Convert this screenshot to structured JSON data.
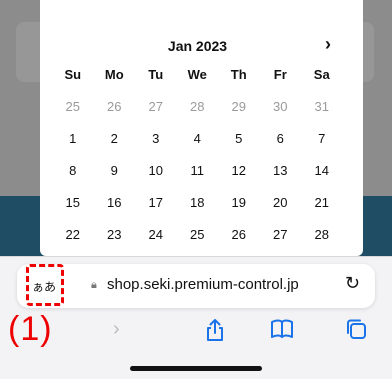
{
  "calendar": {
    "month_label": "Jan 2023",
    "next_icon": "chevron-right-icon",
    "weekdays": [
      "Su",
      "Mo",
      "Tu",
      "We",
      "Th",
      "Fr",
      "Sa"
    ],
    "weeks": [
      [
        "25",
        "26",
        "27",
        "28",
        "29",
        "30",
        "31"
      ],
      [
        "1",
        "2",
        "3",
        "4",
        "5",
        "6",
        "7"
      ],
      [
        "8",
        "9",
        "10",
        "11",
        "12",
        "13",
        "14"
      ],
      [
        "15",
        "16",
        "17",
        "18",
        "19",
        "20",
        "21"
      ],
      [
        "22",
        "23",
        "24",
        "25",
        "26",
        "27",
        "28"
      ]
    ]
  },
  "addressbar": {
    "text_size_label": "ぁあ",
    "url": "shop.seki.premium-control.jp"
  },
  "annotation": {
    "label": "(1)",
    "color": "#e00000"
  },
  "toolbar": {
    "forward_icon": "chevron-right-icon",
    "share_icon": "share-icon",
    "bookmarks_icon": "book-icon",
    "tabs_icon": "tabs-icon"
  }
}
